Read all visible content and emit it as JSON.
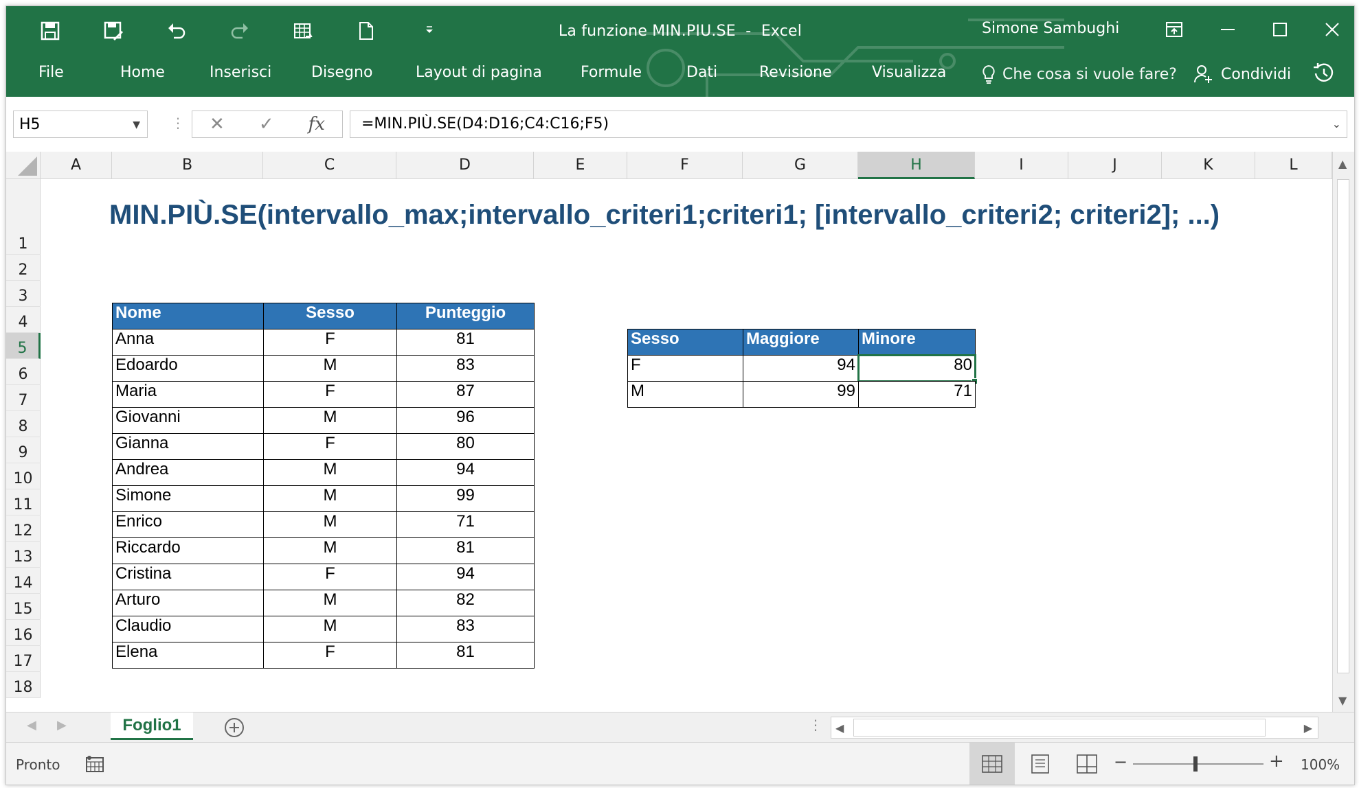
{
  "window": {
    "doc_title": "La funzione MIN.PIU.SE",
    "title_sep": "-",
    "app_name": "Excel",
    "user_name": "Simone Sambughi"
  },
  "ribbon": {
    "tabs": [
      "File",
      "Home",
      "Inserisci",
      "Disegno",
      "Layout di pagina",
      "Formule",
      "Dati",
      "Revisione",
      "Visualizza"
    ],
    "tell_me": "Che cosa si vuole fare?",
    "share": "Condividi"
  },
  "formula_bar": {
    "name_box": "H5",
    "formula": "=MIN.PIÙ.SE(D4:D16;C4:C16;F5)"
  },
  "grid": {
    "columns": [
      "A",
      "B",
      "C",
      "D",
      "E",
      "F",
      "G",
      "H",
      "I",
      "J",
      "K",
      "L"
    ],
    "rows": [
      "1",
      "2",
      "3",
      "4",
      "5",
      "6",
      "7",
      "8",
      "9",
      "10",
      "11",
      "12",
      "13",
      "14",
      "15",
      "16",
      "17",
      "18"
    ],
    "selected_column": "H",
    "selected_row": "5"
  },
  "sheet": {
    "heading": "MIN.PIÙ.SE(intervallo_max;intervallo_criteri1;criteri1; [intervallo_criteri2; criteri2]; ...)",
    "main_table": {
      "headers": [
        "Nome",
        "Sesso",
        "Punteggio"
      ],
      "rows": [
        [
          "Anna",
          "F",
          "81"
        ],
        [
          "Edoardo",
          "M",
          "83"
        ],
        [
          "Maria",
          "F",
          "87"
        ],
        [
          "Giovanni",
          "M",
          "96"
        ],
        [
          "Gianna",
          "F",
          "80"
        ],
        [
          "Andrea",
          "M",
          "94"
        ],
        [
          "Simone",
          "M",
          "99"
        ],
        [
          "Enrico",
          "M",
          "71"
        ],
        [
          "Riccardo",
          "M",
          "81"
        ],
        [
          "Cristina",
          "F",
          "94"
        ],
        [
          "Arturo",
          "M",
          "82"
        ],
        [
          "Claudio",
          "M",
          "83"
        ],
        [
          "Elena",
          "F",
          "81"
        ]
      ]
    },
    "summary_table": {
      "headers": [
        "Sesso",
        "Maggiore",
        "Minore"
      ],
      "rows": [
        [
          "F",
          "94",
          "80"
        ],
        [
          "M",
          "99",
          "71"
        ]
      ]
    }
  },
  "sheet_tabs": {
    "active": "Foglio1"
  },
  "status_bar": {
    "status": "Pronto",
    "zoom": "100%"
  },
  "colors": {
    "ribbon": "#217346",
    "table_header": "#2e74b5",
    "heading_text": "#1f4e79"
  }
}
